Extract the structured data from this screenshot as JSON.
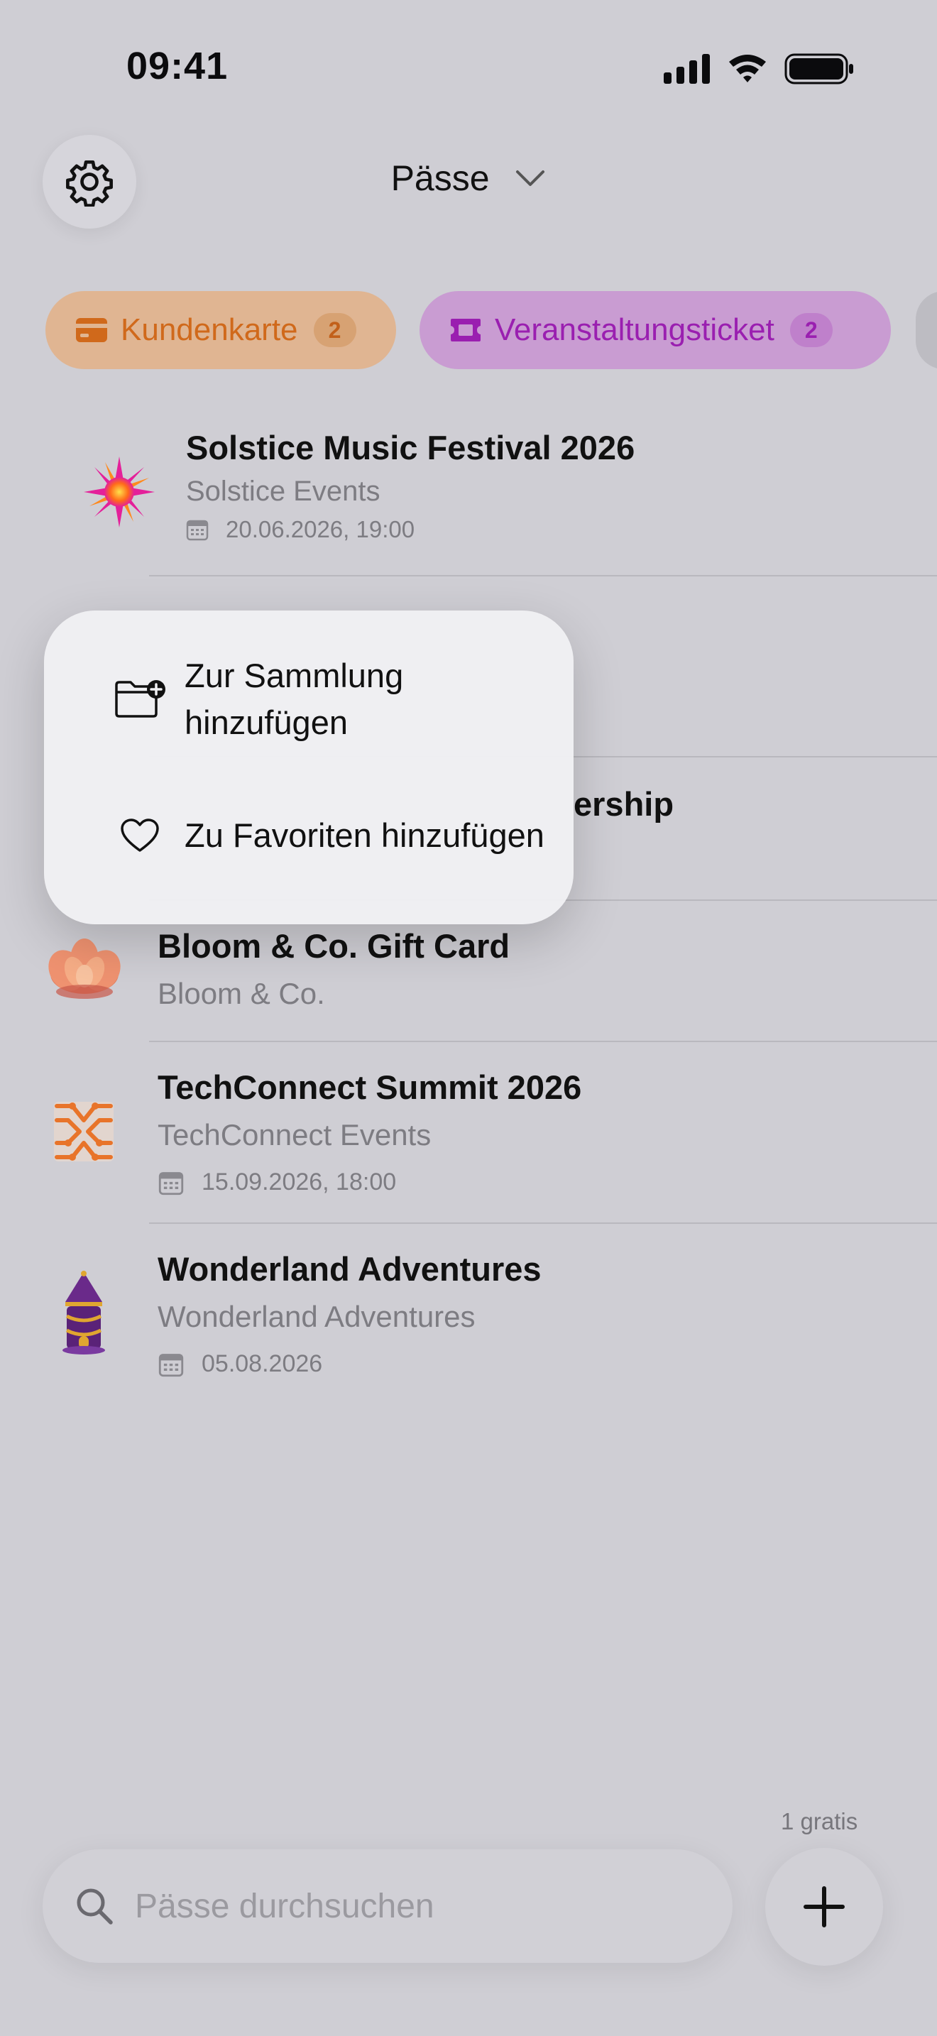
{
  "status_bar": {
    "time": "09:41",
    "icons": [
      "signal-icon",
      "wifi-icon",
      "battery-icon"
    ]
  },
  "header": {
    "title": "Pässe",
    "settings_icon": "gear-icon",
    "dropdown_icon": "chevron-down-icon"
  },
  "filters": [
    {
      "label": "Kundenkarte",
      "count": "2",
      "icon": "credit-card-icon",
      "color": "#d0691b"
    },
    {
      "label": "Veranstaltungsticket",
      "count": "2",
      "icon": "ticket-icon",
      "color": "#9a1fb0"
    }
  ],
  "passes": [
    {
      "title": "Solstice Music Festival 2026",
      "subtitle": "Solstice Events",
      "date": "20.06.2026, 19:00",
      "icon": "sun-logo-icon"
    },
    {
      "title": "",
      "subtitle": "",
      "date": "",
      "icon": "blue-logo-icon"
    },
    {
      "title": "ership",
      "subtitle": "",
      "date": "",
      "icon": "blue-logo-icon"
    },
    {
      "title": "Bloom & Co. Gift Card",
      "subtitle": "Bloom & Co.",
      "date": "",
      "icon": "flower-logo-icon"
    },
    {
      "title": "TechConnect Summit 2026",
      "subtitle": "TechConnect Events",
      "date": "15.09.2026, 18:00",
      "icon": "circuit-logo-icon"
    },
    {
      "title": "Wonderland Adventures",
      "subtitle": "Wonderland Adventures",
      "date": "05.08.2026",
      "icon": "castle-logo-icon"
    }
  ],
  "context_menu": {
    "items": [
      {
        "label": "Zur Sammlung hinzufügen",
        "icon": "folder-add-icon"
      },
      {
        "label": "Zu Favoriten hinzufügen",
        "icon": "heart-icon"
      }
    ]
  },
  "footer": {
    "free_label": "1 gratis",
    "search_placeholder": "Pässe durchsuchen",
    "search_icon": "search-icon",
    "add_icon": "plus-icon"
  }
}
